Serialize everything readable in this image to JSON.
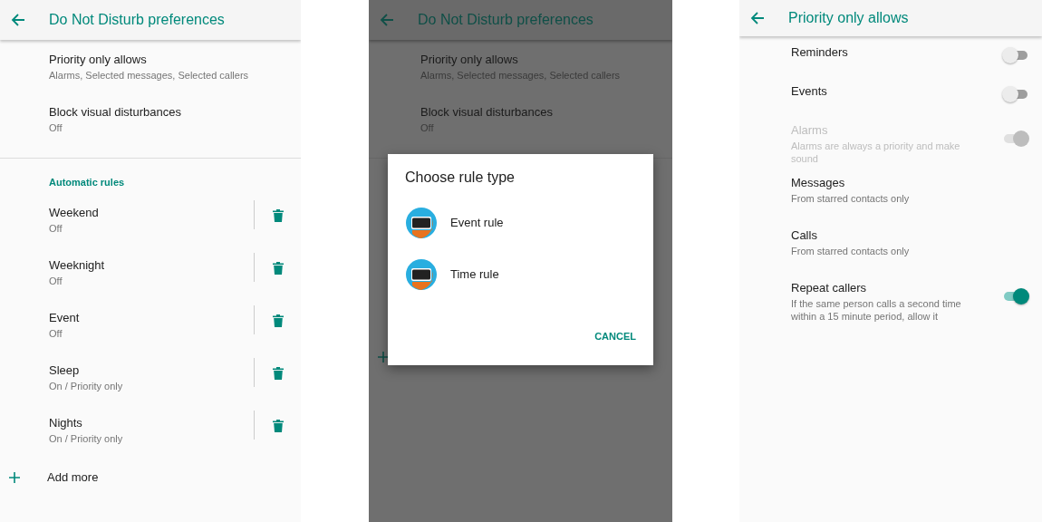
{
  "rules_screen": {
    "title": "Do Not Disturb preferences",
    "settings": [
      {
        "title": "Priority only allows",
        "summary": "Alarms, Selected messages, Selected callers"
      },
      {
        "title": "Block visual disturbances",
        "summary": "Off"
      }
    ],
    "section_label": "Automatic rules",
    "rules": [
      {
        "name": "Weekend",
        "status": "Off"
      },
      {
        "name": "Weeknight",
        "status": "Off"
      },
      {
        "name": "Event",
        "status": "Off"
      },
      {
        "name": "Sleep",
        "status": "On / Priority only"
      },
      {
        "name": "Nights",
        "status": "On / Priority only"
      }
    ],
    "add_label": "Add more"
  },
  "dialog_screen": {
    "title": "Do Not Disturb preferences",
    "settings": [
      {
        "title": "Priority only allows",
        "summary": "Alarms, Selected messages, Selected callers"
      },
      {
        "title": "Block visual disturbances",
        "summary": "Off"
      }
    ],
    "dialog": {
      "title": "Choose rule type",
      "options": [
        "Event rule",
        "Time rule"
      ],
      "cancel": "CANCEL"
    }
  },
  "priority_screen": {
    "title": "Priority only allows",
    "items": [
      {
        "kind": "toggle",
        "title": "Reminders",
        "on": false,
        "disabled": false
      },
      {
        "kind": "toggle",
        "title": "Events",
        "on": false,
        "disabled": false
      },
      {
        "kind": "toggle",
        "title": "Alarms",
        "summary": "Alarms are always a priority and make sound",
        "on": true,
        "disabled": true
      },
      {
        "kind": "choice",
        "title": "Messages",
        "summary": "From starred contacts only"
      },
      {
        "kind": "choice",
        "title": "Calls",
        "summary": "From starred contacts only"
      },
      {
        "kind": "toggle",
        "title": "Repeat callers",
        "summary": "If the same person calls a second time within a 15 minute period, allow it",
        "on": true,
        "disabled": false
      }
    ]
  }
}
